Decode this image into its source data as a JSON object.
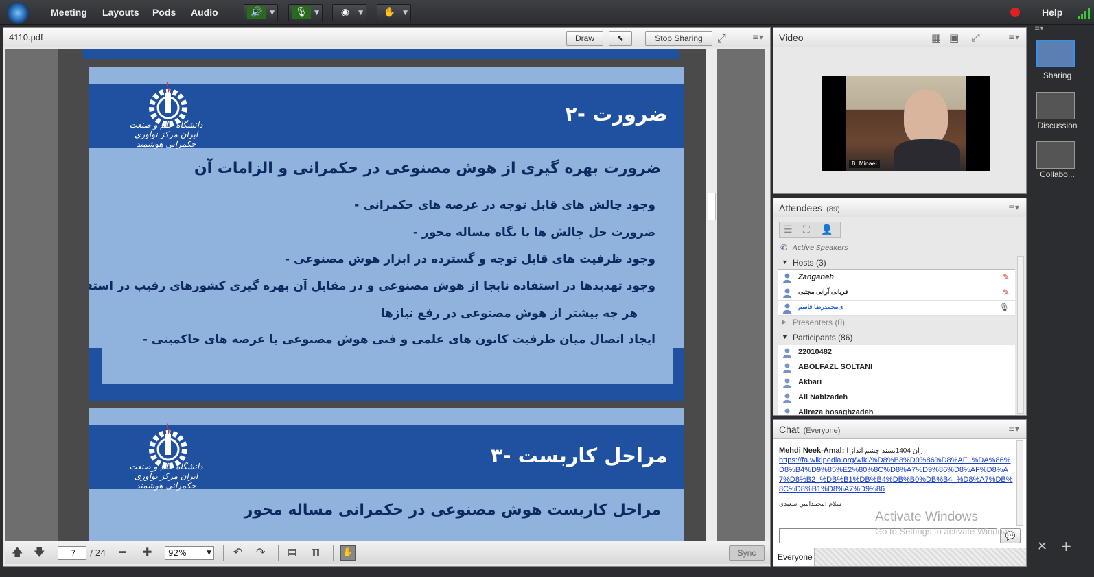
{
  "menubar": {
    "items": [
      "Meeting",
      "Layouts",
      "Pods",
      "Audio"
    ],
    "help": "Help"
  },
  "share_pod": {
    "title": "4110.pdf",
    "draw": "Draw",
    "stop_sharing": "Stop Sharing",
    "page_current": "7",
    "page_total": "/ 24",
    "zoom": "92%",
    "sync": "Sync"
  },
  "slides": [
    {
      "heading": "۲- ضرورت",
      "subheading": "ضرورت بهره گیری از هوش مصنوعی در حکمرانی و الزامات آن",
      "bullets": [
        "-   وجود چالش های قابل توجه در عرصه های حکمرانی",
        "-   ضرورت حل چالش ها با نگاه مساله محور",
        "-   وجود ظرفیت های قابل توجه و گسترده در ابزار هوش مصنوعی",
        "-   وجود تهدیدها در استفاده نابجا از هوش مصنوعی و در مقابل آن بهره گیری کشورهای رقیب در استفاده",
        "هر چه بیشتر از هوش مصنوعی در رفع نیازها",
        "-   ایجاد اتصال میان ظرفیت کانون های علمی و فنی هوش مصنوعی با عرصه های حاکمیتی"
      ],
      "logo_text": "دانشگاه علم و صنعت ایران مرکز نوآوری حکمرانی هوشمند"
    },
    {
      "heading": "۳- مراحل کاربست",
      "subheading": "مراحل کاربست هوش مصنوعی در حکمرانی مساله محور",
      "logo_text": "دانشگاه علم و صنعت ایران مرکز نوآوری حکمرانی هوشمند"
    }
  ],
  "video_pod": {
    "title": "Video",
    "speaker_name": "B. Minaei"
  },
  "attendees_pod": {
    "title": "Attendees",
    "count": "(89)",
    "active_speakers": "Active Speakers",
    "hosts_label": "Hosts (3)",
    "hosts": [
      "Zanganeh",
      "قربانی  آرانی مجتبی",
      "ی‌محمدرضا قاسم"
    ],
    "presenters_label": "Presenters (0)",
    "participants_label": "Participants (86)",
    "participants": [
      "22010482",
      "ABOLFAZL SOLTANI",
      "Akbari",
      "Ali Nabizadeh",
      "Alireza bosaghzadeh"
    ]
  },
  "chat_pod": {
    "title": "Chat",
    "scope": "(Everyone)",
    "message_author": "Mehdi Neek-Amal:",
    "message_text": "زان 1404یسند چشم انداز ا",
    "link": "https://fa.wikipedia.org/wiki/%D8%B3%D9%86%D8%AF_%DA%86%D8%B4%D9%85%E2%80%8C%D8%A7%D9%86%D8%AF%D8%A7%D8%B2_%DB%B1%DB%B4%DB%B0%DB%B4_%D8%A7%DB%8C%D8%B1%D8%A7%D9%86",
    "message2": "سلام :محمدامین سعیدی",
    "recipient": "Everyone"
  },
  "layouts": [
    "Sharing",
    "Discussion",
    "Collabo..."
  ],
  "watermark": {
    "line1": "Activate Windows",
    "line2": "Go to Settings to activate Windows."
  },
  "colors": {
    "slide_band": "#2050a0",
    "slide_bg": "#8fb3dd",
    "record": "#e02020"
  },
  "icons": [
    "speaker-icon",
    "microphone-icon",
    "webcam-icon",
    "raise-hand-icon",
    "pointer-icon",
    "fullscreen-icon",
    "arrow-up-icon",
    "arrow-down-icon",
    "zoom-out-icon",
    "zoom-in-icon",
    "undo-icon",
    "redo-icon",
    "hand-tool-icon",
    "chat-send-icon"
  ]
}
